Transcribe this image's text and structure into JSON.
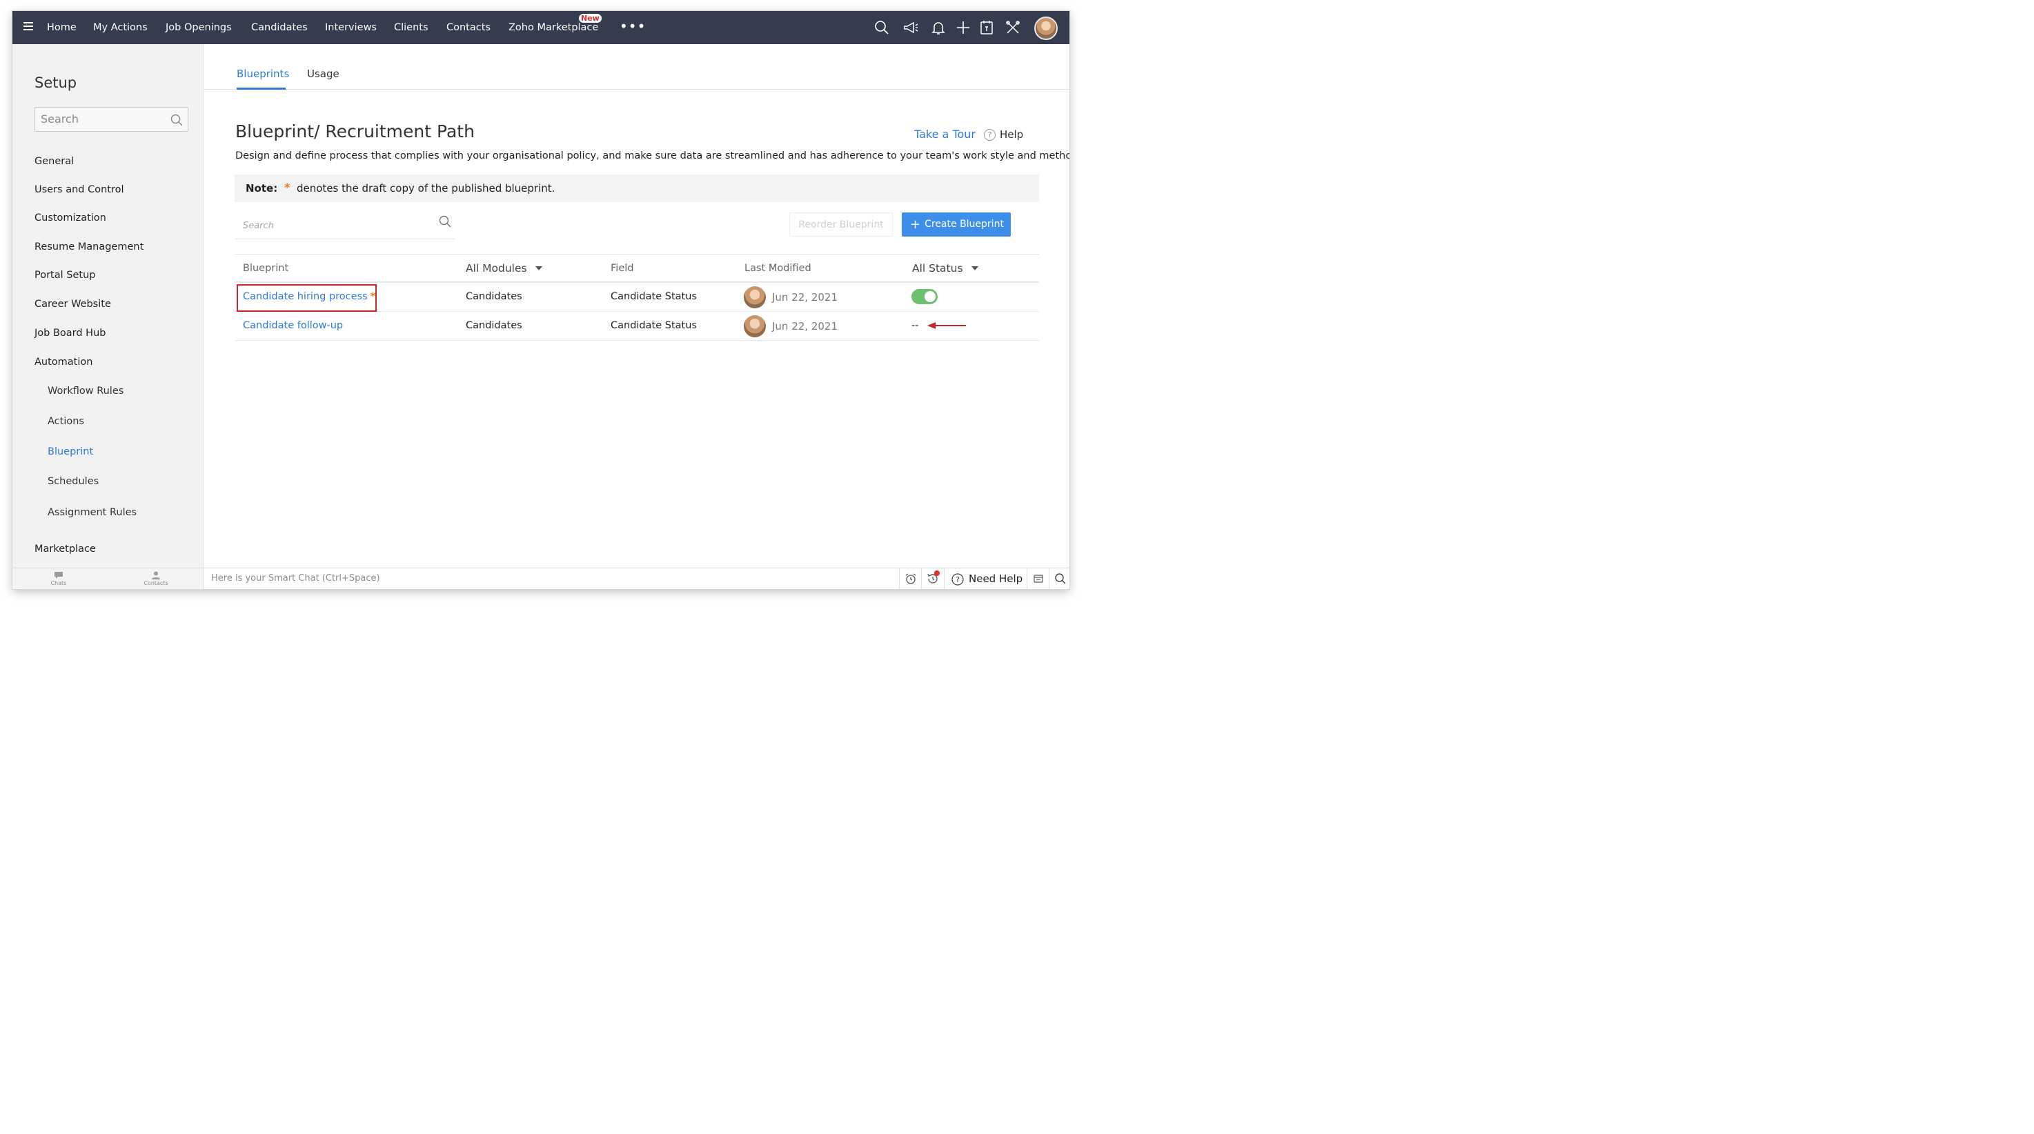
{
  "nav": {
    "items": [
      "Home",
      "My Actions",
      "Job Openings",
      "Candidates",
      "Interviews",
      "Clients",
      "Contacts",
      "Zoho Marketplace"
    ],
    "new_badge": "New",
    "more": "•••"
  },
  "sidebar": {
    "title": "Setup",
    "search_placeholder": "Search",
    "items": [
      "General",
      "Users and Control",
      "Customization",
      "Resume Management",
      "Portal Setup",
      "Career Website",
      "Job Board Hub",
      "Automation"
    ],
    "automation_items": [
      "Workflow Rules",
      "Actions",
      "Blueprint",
      "Schedules",
      "Assignment Rules"
    ],
    "active_item": "Blueprint",
    "last_item": "Marketplace"
  },
  "tabs": {
    "items": [
      "Blueprints",
      "Usage"
    ],
    "active": "Blueprints"
  },
  "page": {
    "title": "Blueprint/ Recruitment Path",
    "take_tour": "Take a Tour",
    "help": "Help",
    "description": "Design and define process that complies with your organisational policy, and make sure data are streamlined and has adherence to your team's work style and method."
  },
  "note": {
    "label": "Note:",
    "star": "*",
    "text": "denotes the draft copy of the published blueprint."
  },
  "toolbar": {
    "search_placeholder": "Search",
    "reorder_label": "Reorder Blueprint",
    "create_label": "Create Blueprint"
  },
  "table": {
    "headers": {
      "blueprint": "Blueprint",
      "modules": "All Modules",
      "field": "Field",
      "last_modified": "Last Modified",
      "status": "All Status"
    },
    "rows": [
      {
        "name": "Candidate hiring process",
        "draft": "*",
        "module": "Candidates",
        "field": "Candidate Status",
        "date": "Jun 22, 2021",
        "status": "active"
      },
      {
        "name": "Candidate follow-up",
        "draft": "",
        "module": "Candidates",
        "field": "Candidate Status",
        "date": "Jun 22, 2021",
        "status": "--"
      }
    ]
  },
  "bottombar": {
    "chats": "Chats",
    "contacts": "Contacts",
    "smart_chat": "Here is your Smart Chat (Ctrl+Space)",
    "need_help": "Need Help"
  },
  "colors": {
    "topbar": "#343c4e",
    "accent": "#2f7ad6",
    "create_button": "#3d8ee8",
    "toggle_on": "#6cc070",
    "draft_star": "#f07c1d",
    "highlight": "#c8262a"
  },
  "icons": [
    "menu-icon",
    "search-icon",
    "megaphone-icon",
    "bell-icon",
    "plus-icon",
    "calendar-icon",
    "tools-icon",
    "help-circle-icon",
    "alarm-icon",
    "history-icon",
    "chat-icon",
    "contacts-icon"
  ]
}
